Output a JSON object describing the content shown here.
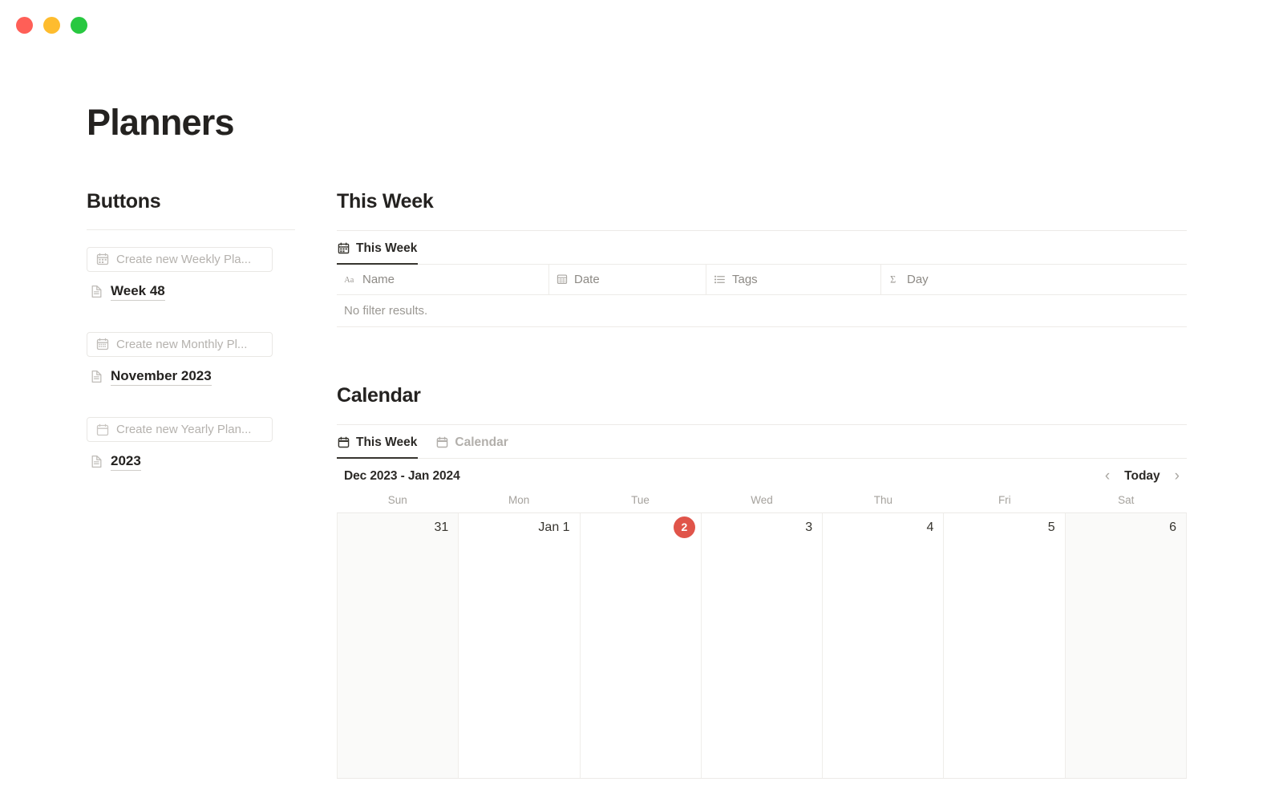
{
  "window": {
    "dots": [
      {
        "name": "close",
        "color": "#ff5f57"
      },
      {
        "name": "minimize",
        "color": "#febc2e"
      },
      {
        "name": "zoom",
        "color": "#28c840"
      }
    ]
  },
  "page": {
    "title": "Planners"
  },
  "sidebar": {
    "heading": "Buttons",
    "groups": [
      {
        "button_label": "Create new Weekly Pla...",
        "button_icon": "calendar-week-icon",
        "doc_label": "Week 48",
        "doc_icon": "page-icon"
      },
      {
        "button_label": "Create new Monthly Pl...",
        "button_icon": "calendar-month-icon",
        "doc_label": "November 2023",
        "doc_icon": "page-icon"
      },
      {
        "button_label": "Create new Yearly Plan...",
        "button_icon": "calendar-year-icon",
        "doc_label": "2023",
        "doc_icon": "page-icon"
      }
    ]
  },
  "this_week_block": {
    "heading": "This Week",
    "tabs": [
      {
        "label": "This Week",
        "icon": "calendar-table-icon",
        "active": true
      }
    ],
    "table": {
      "columns": [
        {
          "label": "Name",
          "icon": "text-type-icon"
        },
        {
          "label": "Date",
          "icon": "date-type-icon"
        },
        {
          "label": "Tags",
          "icon": "multiselect-type-icon"
        },
        {
          "label": "Day",
          "icon": "formula-type-icon"
        }
      ],
      "empty_message": "No filter results."
    }
  },
  "calendar_block": {
    "heading": "Calendar",
    "tabs": [
      {
        "label": "This Week",
        "icon": "calendar-view-icon",
        "active": true
      },
      {
        "label": "Calendar",
        "icon": "calendar-view-icon",
        "active": false
      }
    ],
    "range_label": "Dec 2023 - Jan 2024",
    "nav": {
      "prev": "‹",
      "today": "Today",
      "next": "›"
    },
    "weekdays": [
      "Sun",
      "Mon",
      "Tue",
      "Wed",
      "Thu",
      "Fri",
      "Sat"
    ],
    "days": [
      {
        "label": "31",
        "today": false,
        "weekend": true
      },
      {
        "label": "Jan 1",
        "today": false,
        "weekend": false
      },
      {
        "label": "2",
        "today": true,
        "weekend": false
      },
      {
        "label": "3",
        "today": false,
        "weekend": false
      },
      {
        "label": "4",
        "today": false,
        "weekend": false
      },
      {
        "label": "5",
        "today": false,
        "weekend": false
      },
      {
        "label": "6",
        "today": false,
        "weekend": true
      }
    ],
    "today_color": "#e0544a"
  }
}
